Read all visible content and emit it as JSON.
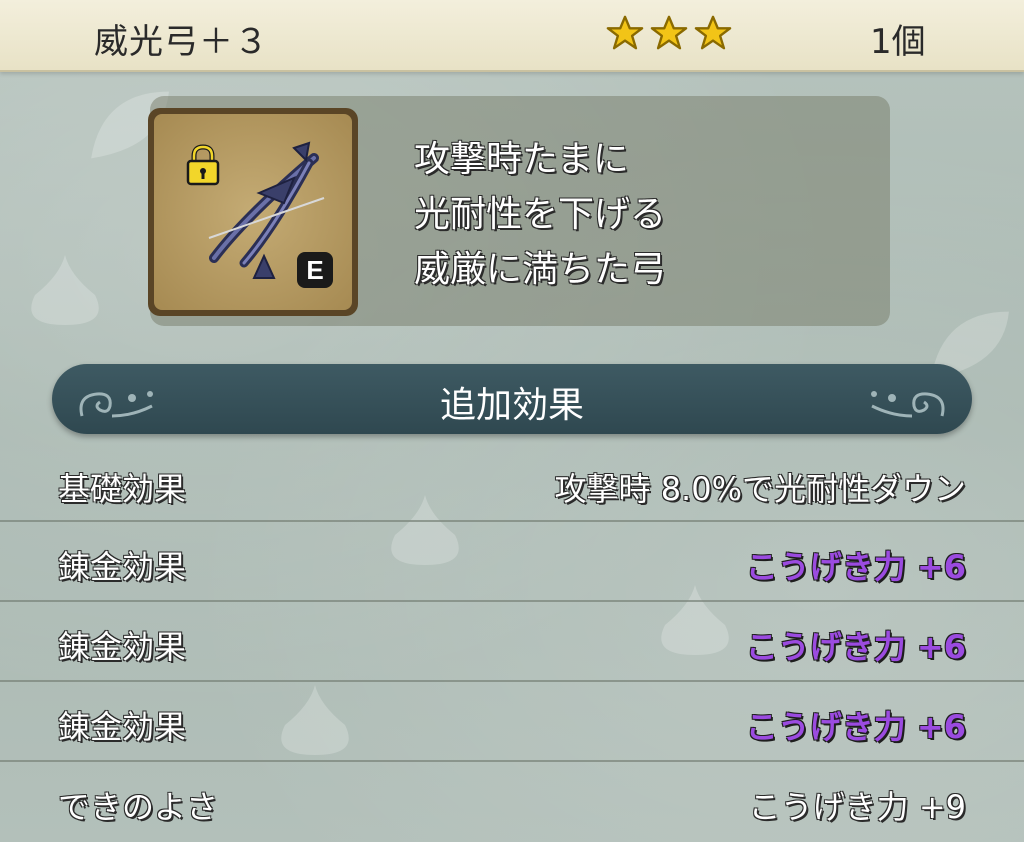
{
  "header": {
    "item_name": "威光弓＋３",
    "rarity_stars": 3,
    "quantity": "1個",
    "star_color": "#f2c417"
  },
  "item": {
    "icon": "bow-icon",
    "locked": true,
    "lock_icon": "padlock-icon",
    "equipped_badge": "E",
    "description_lines": [
      "攻撃時たまに",
      "光耐性を下げる",
      "威厳に満ちた弓"
    ]
  },
  "section": {
    "title": "追加効果"
  },
  "effects": [
    {
      "label": "基礎効果",
      "value": "攻撃時  8.0%で光耐性ダウン",
      "type": "base"
    },
    {
      "label": "錬金効果",
      "value": "こうげき力 +6",
      "type": "alchemy"
    },
    {
      "label": "錬金効果",
      "value": "こうげき力 +6",
      "type": "alchemy"
    },
    {
      "label": "錬金効果",
      "value": "こうげき力 +6",
      "type": "alchemy"
    },
    {
      "label": "できのよさ",
      "value": "こうげき力 +9",
      "type": "quality"
    }
  ],
  "colors": {
    "alchemy_text": "#9b4be0",
    "banner": "#34505a",
    "header_bg": "#efe9d1"
  }
}
